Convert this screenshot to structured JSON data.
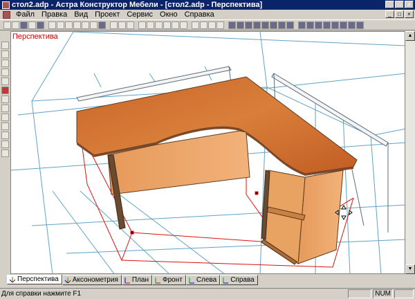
{
  "window": {
    "title": "стол2.adp - Астра Конструктор Мебели - [стол2.adp - Перспектива]"
  },
  "menu": [
    "Файл",
    "Правка",
    "Вид",
    "Проект",
    "Сервис",
    "Окно",
    "Справка"
  ],
  "canvas": {
    "label": "Перспектива"
  },
  "tabs": [
    {
      "label": "Перспектива",
      "active": true
    },
    {
      "label": "Аксонометрия",
      "active": false
    },
    {
      "label": "План",
      "active": false
    },
    {
      "label": "Фронт",
      "active": false
    },
    {
      "label": "Слева",
      "active": false
    },
    {
      "label": "Справа",
      "active": false
    }
  ],
  "status": {
    "help": "Для справки нажмите F1",
    "num": "NUM"
  },
  "colors": {
    "titlebar": "#0a246a",
    "wood": "#d2752c",
    "wireframe": "#5fa3c4",
    "selection": "#e01010"
  }
}
